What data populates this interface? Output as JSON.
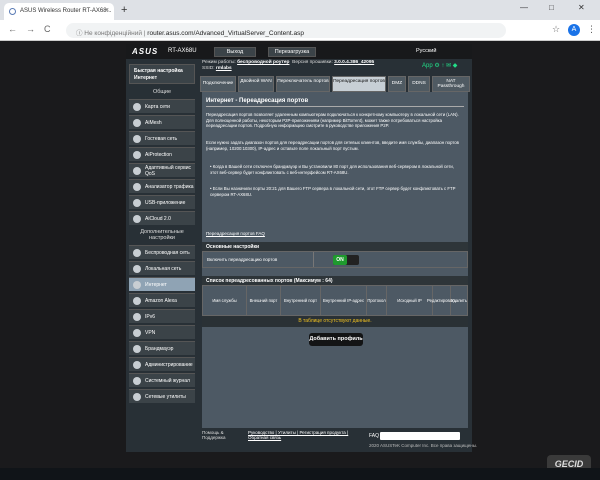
{
  "browser": {
    "tab_title": "ASUS Wireless Router RT-AX68...",
    "tab_close": "×",
    "new_tab": "+",
    "back": "←",
    "forward": "→",
    "reload": "C",
    "security": "ⓘ Не конфіденційний",
    "url": "router.asus.com/Advanced_VirtualServer_Content.asp",
    "star": "☆",
    "avatar": "A",
    "menu": "⋮",
    "win_min": "—",
    "win_max": "□",
    "win_close": "✕"
  },
  "router": {
    "brand": "ASUS",
    "model": "RT-AX68U",
    "logout": "Выход",
    "reboot": "Перезагрузка",
    "language": "Русский",
    "status": {
      "mode_label": "Режим работы:",
      "mode_value": "беспроводной роутер",
      "firmware_label": "Версия прошивки:",
      "firmware_value": "3.0.0.4.386_42095",
      "ssid_label": "SSID:",
      "ssid_value": "rmlabs"
    },
    "status_icons": "App ⚙ ↑ ✉ ◆",
    "sidebar": {
      "qis": "Быстрая настройка Интернет",
      "general_header": "Общие",
      "general": [
        "Карта сети",
        "AiMesh",
        "Гостевая сеть",
        "AiProtection",
        "Адаптивный сервис QoS",
        "Анализатор трафика",
        "USB-приложение",
        "AiCloud 2.0"
      ],
      "advanced_header": "Дополнительные настройки",
      "advanced": [
        "Беспроводная сеть",
        "Локальная сеть",
        "Интернет",
        "Amazon Alexa",
        "IPv6",
        "VPN",
        "Брандмауэр",
        "Администрирование",
        "Системный журнал",
        "Сетевые утилиты"
      ]
    },
    "tabs": [
      "Подключение",
      "Двойной WAN",
      "Переключатель портов",
      "Переадресация портов",
      "DMZ",
      "DDNS",
      "NAT Passthrough"
    ],
    "content": {
      "title": "Интернет - Переадресация портов",
      "p1": "Переадресация портов позволяет удаленным компьютерам подключаться к конкретному компьютеру в локальной сети (LAN). Для полноценной работы, некоторым P2P-приложениям (например BitTorrent), может также потребоваться настройка переадресации портов. Подробную информацию смотрите в руководстве приложения P2P.",
      "p2": "Если нужно задать диапазон портов для переадресации портов для сетевых клиентов, введите имя службы, диапазон портов (например, 10200:10300), IP-адрес и оставьте поле локальный порт пустым.",
      "b1": "• Когда в Вашей сети отключен брандмауэр и Вы установили 80 порт для использования веб-сервером в локальной сети, этот веб-сервер будет конфликтовать с веб-интерфейсом RT-AX68U.",
      "b2": "• Если Вы назначили порты 20:21 для Вашего FTP сервера в локальной сети, этот FTP сервер будет конфликтовать с FTP сервером RT-AX68U.",
      "faq_link": "Переадресация портов FAQ",
      "basic_header": "Основные настройки",
      "enable_label": "Включить переадресацию портов",
      "toggle_on": "ON",
      "list_header": "Список переадресованных портов (Максимум : 64)",
      "columns": [
        "Имя службы",
        "Внешний порт",
        "Внутренний порт",
        "Внутренний IP-адрес",
        "Протокол",
        "Исходный IP",
        "Редактировать",
        "Удалить"
      ],
      "empty": "В таблице отсутствуют данные.",
      "add_button": "Добавить профиль"
    },
    "footer": {
      "help": "Помощь & Поддержка",
      "links": "Руководство | Утилиты | Регистрация продукта | Обратная связь",
      "faq": "FAQ",
      "copyright": "2020 ASUSTeK Computer Inc. Все права защищены."
    }
  },
  "watermark": "GECID"
}
